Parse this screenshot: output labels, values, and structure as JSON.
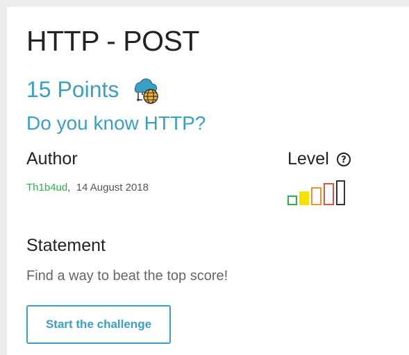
{
  "challenge": {
    "title": "HTTP - POST",
    "points": "15 Points",
    "category_icon": "cloud-web-icon",
    "subtitle": "Do you know HTTP?"
  },
  "author": {
    "heading": "Author",
    "name": "Th1b4ud",
    "separator": ",",
    "date": "14 August 2018",
    "name_color": "#2bb24c"
  },
  "level": {
    "heading": "Level",
    "help_icon": "question-circle-icon",
    "current": 2,
    "max": 5,
    "bar_colors": [
      "#2bb24c",
      "#f4e300",
      "#e8913a",
      "#d9533f",
      "#333333"
    ]
  },
  "statement": {
    "heading": "Statement",
    "text": "Find a way to beat the top score!"
  },
  "actions": {
    "start_label": "Start the challenge"
  },
  "colors": {
    "accent": "#3b9fc2",
    "background": "#ececec"
  }
}
